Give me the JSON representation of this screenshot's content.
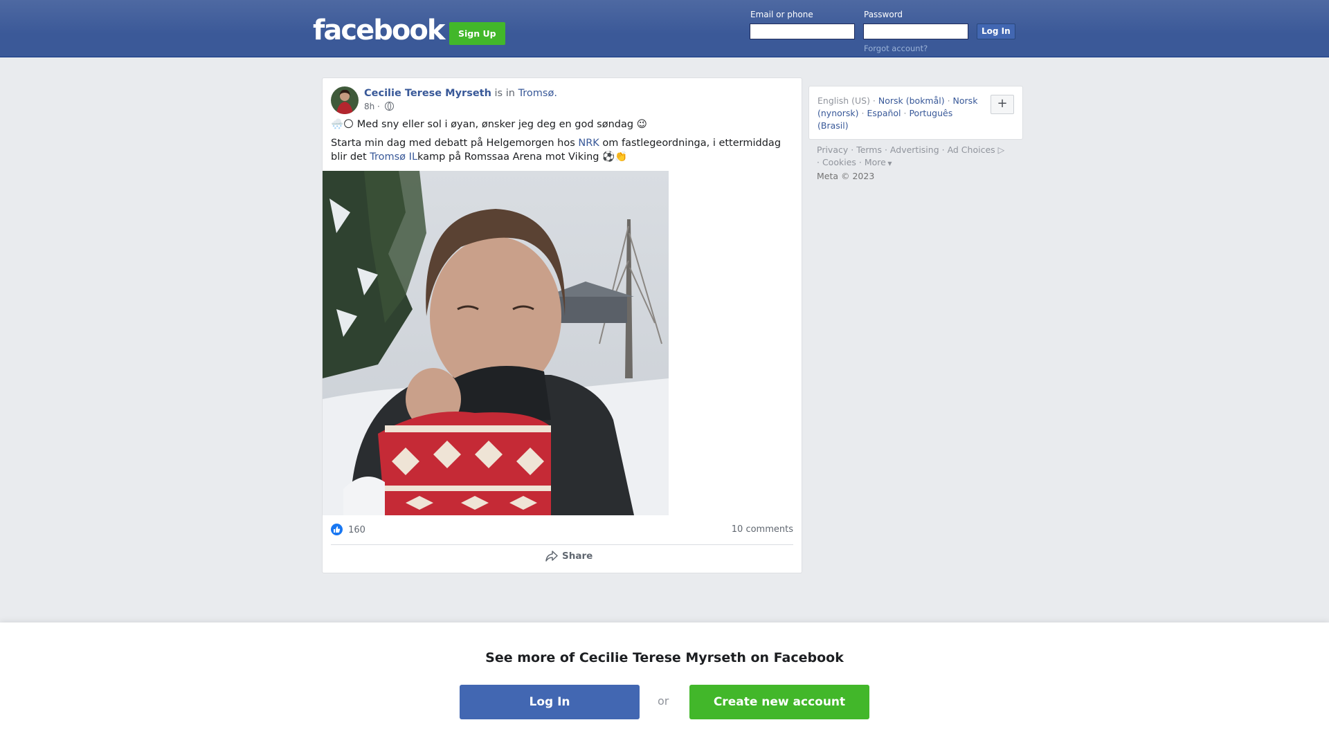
{
  "header": {
    "logo": "facebook",
    "signup_label": "Sign Up",
    "email_label": "Email or phone",
    "password_label": "Password",
    "login_label": "Log In",
    "forgot_label": "Forgot account?"
  },
  "post": {
    "author": "Cecilie Terese Myrseth",
    "is_in": "is in",
    "location": "Tromsø.",
    "time": "8h ·",
    "line1": "🌨️🌕 Med sny eller sol i øyan, ønsker jeg deg en god søndag 😉",
    "line2_a": "Starta min dag med debatt på Helgemorgen hos ",
    "line2_link1": "NRK",
    "line2_b": " om fastlegeordninga, i ettermiddag blir det ",
    "line2_link2": "Tromsø IL",
    "line2_c": "kamp på Romssaa Arena mot Viking ⚽👏",
    "likes": "160",
    "comments": "10 comments",
    "share_label": "Share"
  },
  "sidebar": {
    "languages": [
      {
        "label": "English (US)",
        "current": true
      },
      {
        "label": "Norsk (bokmål)",
        "current": false
      },
      {
        "label": "Norsk (nynorsk)",
        "current": false
      },
      {
        "label": "Español",
        "current": false
      },
      {
        "label": "Português (Brasil)",
        "current": false
      }
    ],
    "plus_label": "+",
    "footer": {
      "privacy": "Privacy",
      "terms": "Terms",
      "advertising": "Advertising",
      "ad_choices": "Ad Choices",
      "cookies": "Cookies",
      "more": "More",
      "copyright": "Meta © 2023"
    }
  },
  "banner": {
    "title": "See more of Cecilie Terese Myrseth on Facebook",
    "login_label": "Log In",
    "or_label": "or",
    "create_label": "Create new account"
  },
  "colors": {
    "brand_blue": "#3b5998",
    "green": "#42b72a",
    "link": "#385898",
    "background": "#e9ebee"
  }
}
